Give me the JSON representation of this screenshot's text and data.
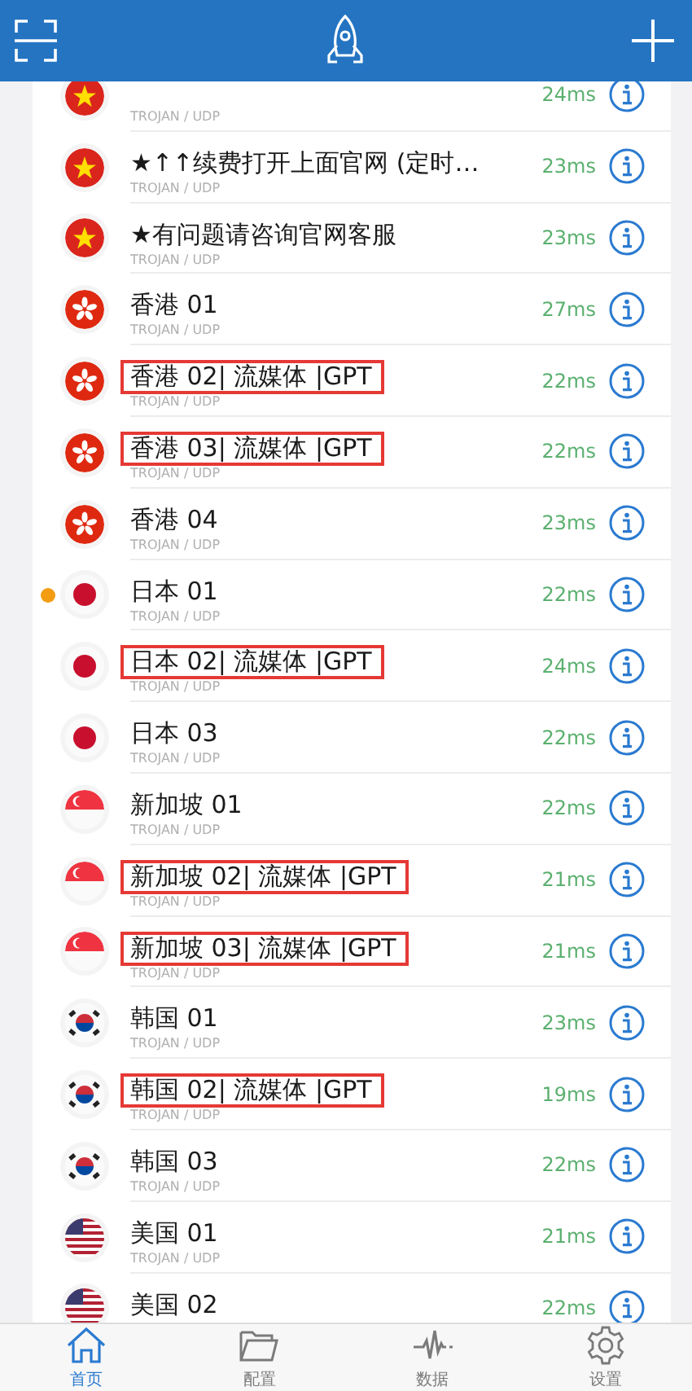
{
  "rows": [
    {
      "kind": "vn",
      "protocol": "TROJAN / UDP",
      "latency": "24ms",
      "selected": false
    },
    {
      "kind": "vn",
      "title": "★↑↑续费打开上面官网 (定时…",
      "protocol": "TROJAN / UDP",
      "latency": "23ms",
      "selected": false,
      "highlighted": false
    },
    {
      "kind": "vn",
      "title": "★有问题请咨询官网客服",
      "protocol": "TROJAN / UDP",
      "latency": "23ms",
      "selected": false,
      "highlighted": false
    },
    {
      "kind": "hk",
      "title": "香港 01",
      "protocol": "TROJAN / UDP",
      "latency": "27ms",
      "selected": false,
      "highlighted": false
    },
    {
      "kind": "hk",
      "title": "香港 02| 流媒体 |GPT",
      "protocol": "TROJAN / UDP",
      "latency": "22ms",
      "selected": false,
      "highlighted": true
    },
    {
      "kind": "hk",
      "title": "香港 03| 流媒体 |GPT",
      "protocol": "TROJAN / UDP",
      "latency": "22ms",
      "selected": false,
      "highlighted": true
    },
    {
      "kind": "hk",
      "title": "香港 04",
      "protocol": "TROJAN / UDP",
      "latency": "23ms",
      "selected": false,
      "highlighted": false
    },
    {
      "kind": "jp",
      "title": "日本 01",
      "protocol": "TROJAN / UDP",
      "latency": "22ms",
      "selected": true,
      "highlighted": false
    },
    {
      "kind": "jp",
      "title": "日本 02| 流媒体 |GPT",
      "protocol": "TROJAN / UDP",
      "latency": "24ms",
      "selected": false,
      "highlighted": true
    },
    {
      "kind": "jp",
      "title": "日本 03",
      "protocol": "TROJAN / UDP",
      "latency": "22ms",
      "selected": false,
      "highlighted": false
    },
    {
      "kind": "sg",
      "title": "新加坡 01",
      "protocol": "TROJAN / UDP",
      "latency": "22ms",
      "selected": false,
      "highlighted": false
    },
    {
      "kind": "sg",
      "title": "新加坡 02| 流媒体 |GPT",
      "protocol": "TROJAN / UDP",
      "latency": "21ms",
      "selected": false,
      "highlighted": true
    },
    {
      "kind": "sg",
      "title": "新加坡 03| 流媒体 |GPT",
      "protocol": "TROJAN / UDP",
      "latency": "21ms",
      "selected": false,
      "highlighted": true
    },
    {
      "kind": "kr",
      "title": "韩国 01",
      "protocol": "TROJAN / UDP",
      "latency": "23ms",
      "selected": false,
      "highlighted": false
    },
    {
      "kind": "kr",
      "title": "韩国 02| 流媒体 |GPT",
      "protocol": "TROJAN / UDP",
      "latency": "19ms",
      "selected": false,
      "highlighted": true
    },
    {
      "kind": "kr",
      "title": "韩国 03",
      "protocol": "TROJAN / UDP",
      "latency": "22ms",
      "selected": false,
      "highlighted": false
    },
    {
      "kind": "us",
      "title": "美国 01",
      "protocol": "TROJAN / UDP",
      "latency": "21ms",
      "selected": false,
      "highlighted": false
    },
    {
      "kind": "us",
      "title": "美国 02",
      "latency": "22ms",
      "selected": false,
      "highlighted": false
    }
  ],
  "tabs": [
    {
      "kind": "home",
      "label": "首页",
      "selected": true
    },
    {
      "kind": "config",
      "label": "配置",
      "selected": false
    },
    {
      "kind": "data",
      "label": "数据",
      "selected": false
    },
    {
      "kind": "settings",
      "label": "设置",
      "selected": false
    }
  ]
}
